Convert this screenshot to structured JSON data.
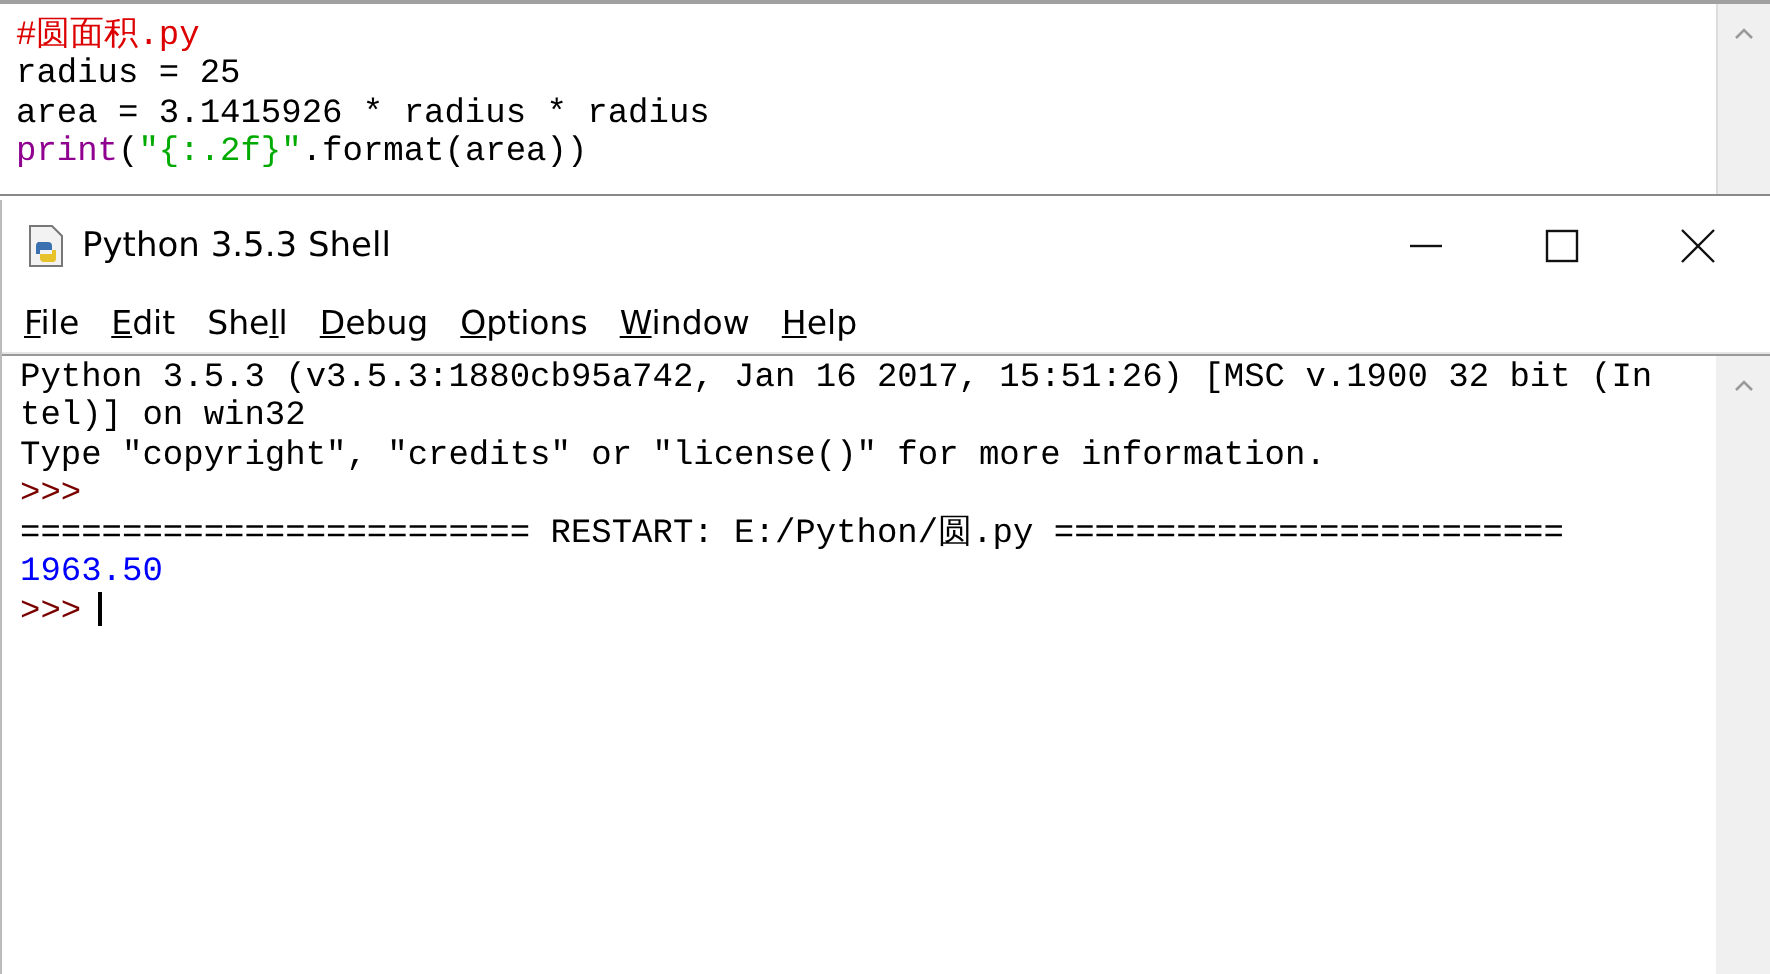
{
  "editor": {
    "lines": [
      [
        {
          "kind": "comment",
          "text": "#圆面积.py"
        }
      ],
      [
        {
          "kind": "plain",
          "text": "radius = 25"
        }
      ],
      [
        {
          "kind": "plain",
          "text": "area = 3.1415926 * radius * radius"
        }
      ],
      [
        {
          "kind": "builtin",
          "text": "print"
        },
        {
          "kind": "plain",
          "text": "("
        },
        {
          "kind": "string",
          "text": "\"{:.2f}\""
        },
        {
          "kind": "plain",
          "text": ".format(area))"
        }
      ]
    ]
  },
  "shell": {
    "title": "Python 3.5.3 Shell",
    "menu": [
      {
        "key": "F",
        "post": "ile"
      },
      {
        "key": "E",
        "post": "dit"
      },
      {
        "pre": "She",
        "key": "l",
        "post": "l"
      },
      {
        "key": "D",
        "post": "ebug"
      },
      {
        "key": "O",
        "post": "ptions"
      },
      {
        "key": "W",
        "post": "indow"
      },
      {
        "key": "H",
        "post": "elp"
      }
    ],
    "lines": [
      {
        "kind": "text",
        "text": "Python 3.5.3 (v3.5.3:1880cb95a742, Jan 16 2017, 15:51:26) [MSC v.1900 32 bit (In"
      },
      {
        "kind": "text",
        "text": "tel)] on win32"
      },
      {
        "kind": "text",
        "text": "Type \"copyright\", \"credits\" or \"license()\" for more information."
      },
      {
        "kind": "prompt",
        "text": ">>>"
      },
      {
        "kind": "text",
        "text": "========================= RESTART: E:/Python/圆.py ========================="
      },
      {
        "kind": "output",
        "text": "1963.50"
      },
      {
        "kind": "prompt",
        "text": ">>>",
        "cursor": true
      }
    ]
  }
}
